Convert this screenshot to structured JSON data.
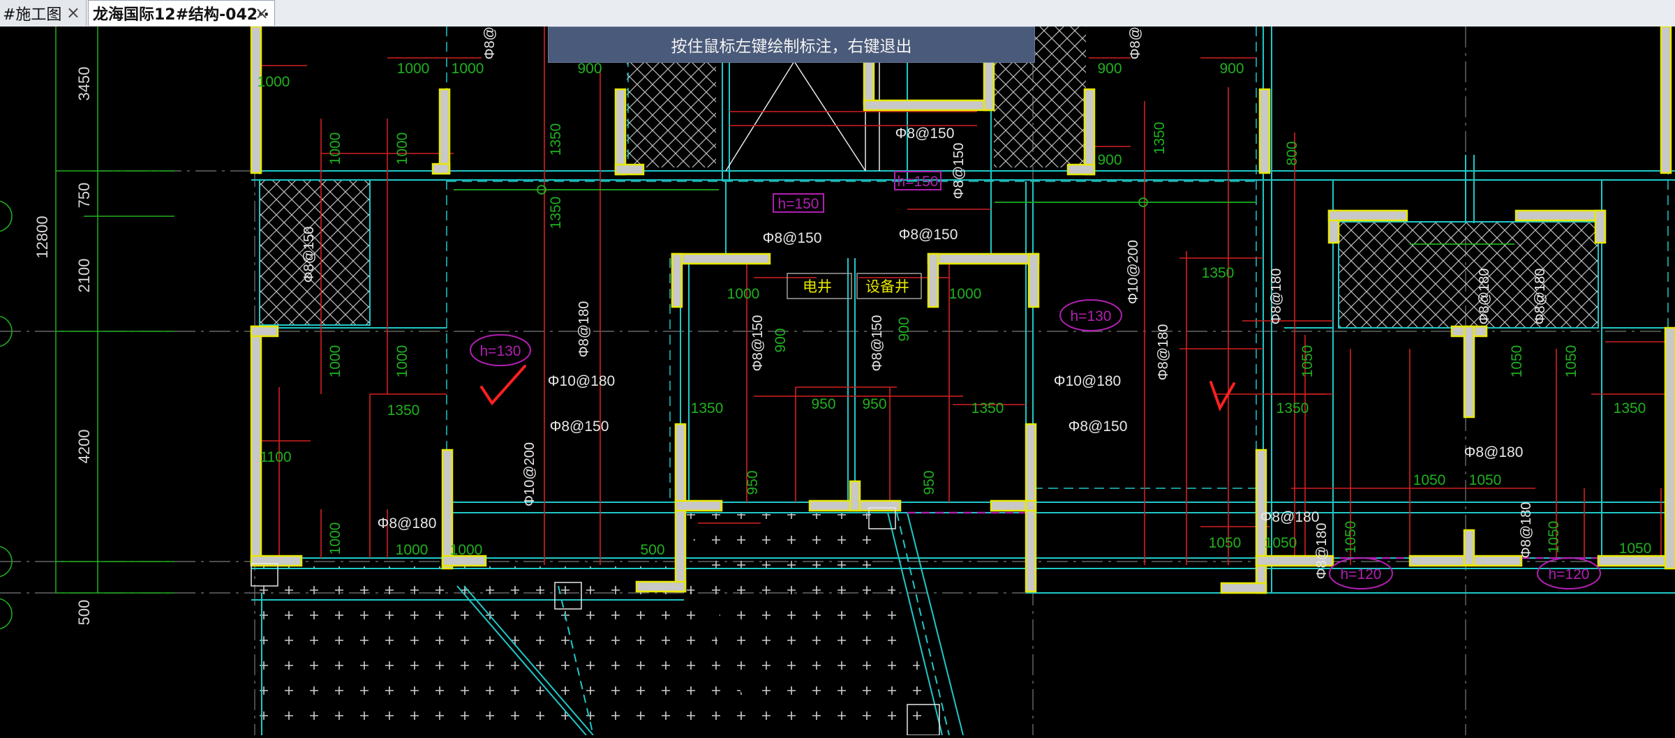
{
  "tabs": [
    {
      "label": "#施工图",
      "close": "×"
    },
    {
      "label": "龙海国际12#结构-042··",
      "close": "×"
    }
  ],
  "tooltip": "按住鼠标左键绘制标注，右键退出",
  "dims_vertical": [
    "3450",
    "750",
    "2100",
    "4200",
    "500"
  ],
  "dim_total": "12800",
  "dims_green": [
    "1000",
    "1000",
    "1000",
    "900",
    "900",
    "900",
    "900",
    "1000",
    "1000",
    "1000",
    "1350",
    "1350",
    "950",
    "950",
    "1350",
    "1350",
    "1050",
    "1050",
    "1050",
    "1050",
    "1350",
    "1100",
    "1000",
    "1000",
    "500",
    "1050",
    "1050",
    "1050",
    "950",
    "950",
    "900",
    "900",
    "1350",
    "1050",
    "1050",
    "1350"
  ],
  "dims_green_vertical": [
    "1000",
    "1000",
    "1350",
    "1350",
    "1350",
    "1000",
    "1000",
    "800",
    "1050",
    "1050",
    "1050",
    "1000",
    "950",
    "950",
    "900"
  ],
  "rebar": [
    "Φ8@150",
    "Φ8@150",
    "Φ8@150",
    "Φ10@180",
    "Φ8@150",
    "Φ10@180",
    "Φ8@150",
    "Φ8@180",
    "Φ8@180",
    "Φ8@180",
    "Φ8@180"
  ],
  "rebar_vertical": [
    "Φ8@150",
    "Φ8@180",
    "Φ10@200",
    "Φ8@150",
    "Φ8@150",
    "Φ10@200",
    "Φ8@180",
    "Φ8@180",
    "Φ8@180",
    "Φ8@180",
    "Φ8@180",
    "Φ8@180",
    "Φ8@180"
  ],
  "h_labels": [
    "h=150",
    "h=150",
    "h=130",
    "h=130",
    "h=120",
    "h=120"
  ],
  "shaft_labels": [
    "电井",
    "设备井"
  ],
  "colors": {
    "wall_fill": "#c8c8c8",
    "wall_edge": "#e8e800",
    "cyan": "#20c8c8",
    "red": "#d42020",
    "green": "#20b020",
    "magenta": "#b020b0",
    "white": "#e8e8e8",
    "grid": "#909090"
  }
}
